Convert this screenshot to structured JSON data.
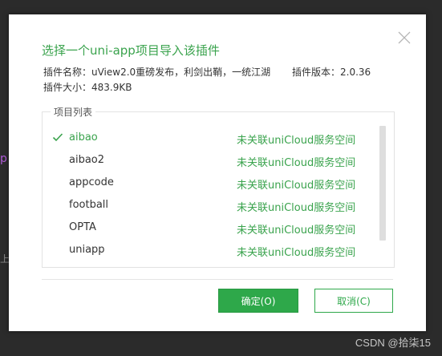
{
  "background": {
    "left_fragment": "p",
    "left_fragment2": "上",
    "watermark": "CSDN @拾柒15"
  },
  "dialog": {
    "title": "选择一个uni-app项目导入该插件",
    "plugin_name": "插件名称：uView2.0重磅发布，利剑出鞘，一统江湖",
    "plugin_version": "插件版本：2.0.36",
    "plugin_size": "插件大小：483.9KB",
    "group_label": "项目列表",
    "projects": [
      {
        "name": "aibao",
        "cloud": "未关联uniCloud服务空间",
        "selected": true
      },
      {
        "name": "aibao2",
        "cloud": "未关联uniCloud服务空间",
        "selected": false
      },
      {
        "name": "appcode",
        "cloud": "未关联uniCloud服务空间",
        "selected": false
      },
      {
        "name": "football",
        "cloud": "未关联uniCloud服务空间",
        "selected": false
      },
      {
        "name": "OPTA",
        "cloud": "未关联uniCloud服务空间",
        "selected": false
      },
      {
        "name": "uniapp",
        "cloud": "未关联uniCloud服务空间",
        "selected": false
      }
    ],
    "ok_label": "确定(O)",
    "cancel_label": "取消(C)",
    "accent_color": "#3aa34d",
    "icons": {
      "close": "close-icon",
      "check": "check-icon"
    }
  }
}
